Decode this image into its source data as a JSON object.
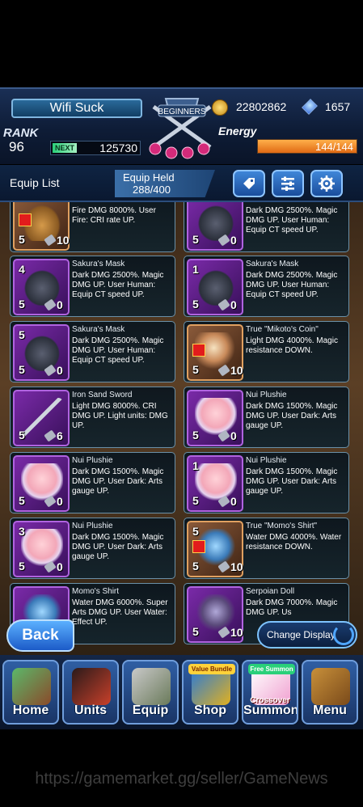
{
  "header": {
    "player_name": "Wifi Suck",
    "emblem_text": "BEGINNERS",
    "rank_label": "RANK",
    "rank": "96",
    "next_label": "NEXT",
    "next_xp": "125730",
    "coins": "22802862",
    "gems": "1657",
    "energy_label": "Energy",
    "energy": "144/144",
    "energy_fraction": 1.0
  },
  "subbar": {
    "title": "Equip List",
    "held_label": "Equip Held",
    "held_value": "288/400",
    "buttons": [
      "tag-icon",
      "filter-icon",
      "gear-icon"
    ]
  },
  "cards": [
    {
      "name": "",
      "level": "5",
      "count": "10",
      "desc": "Fire DMG 8000%. User Fire: CRI rate UP.",
      "art": "hat",
      "frame": "red"
    },
    {
      "name": "",
      "level": "5",
      "count": "0",
      "desc": "Dark DMG 2500%. Magic DMG UP. User Human: Equip CT speed UP.",
      "art": "mask",
      "frame": "purple"
    },
    {
      "name": "Sakura's Mask",
      "level": "5",
      "count": "0",
      "desc": "Dark DMG 2500%. Magic DMG UP. User Human: Equip CT speed UP.",
      "art": "mask",
      "frame": "purple",
      "top": "4"
    },
    {
      "name": "Sakura's Mask",
      "level": "5",
      "count": "0",
      "desc": "Dark DMG 2500%. Magic DMG UP. User Human: Equip CT speed UP.",
      "art": "mask",
      "frame": "purple",
      "top": "1"
    },
    {
      "name": "Sakura's Mask",
      "level": "5",
      "count": "0",
      "desc": "Dark DMG 2500%. Magic DMG UP. User Human: Equip CT speed UP.",
      "art": "mask",
      "frame": "purple",
      "top": "5"
    },
    {
      "name": "True \"Mikoto's Coin\"",
      "level": "5",
      "count": "10",
      "desc": "Light DMG 4000%. Magic resistance DOWN.",
      "art": "coin",
      "frame": "red"
    },
    {
      "name": "Iron Sand Sword",
      "level": "5",
      "count": "6",
      "desc": "Light DMG 8000%. CRI DMG UP. Light units: DMG UP.",
      "art": "sword",
      "frame": "purple"
    },
    {
      "name": "Nui Plushie",
      "level": "5",
      "count": "0",
      "desc": "Dark DMG 1500%. Magic DMG UP. User Dark: Arts gauge UP.",
      "art": "plush",
      "frame": "purple"
    },
    {
      "name": "Nui Plushie",
      "level": "5",
      "count": "0",
      "desc": "Dark DMG 1500%. Magic DMG UP. User Dark: Arts gauge UP.",
      "art": "plush",
      "frame": "purple"
    },
    {
      "name": "Nui Plushie",
      "level": "5",
      "count": "0",
      "desc": "Dark DMG 1500%. Magic DMG UP. User Dark: Arts gauge UP.",
      "art": "plush",
      "frame": "purple",
      "top": "1"
    },
    {
      "name": "Nui Plushie",
      "level": "5",
      "count": "0",
      "desc": "Dark DMG 1500%. Magic DMG UP. User Dark: Arts gauge UP.",
      "art": "plush",
      "frame": "purple",
      "top": "3"
    },
    {
      "name": "True \"Momo's Shirt\"",
      "level": "5",
      "count": "10",
      "desc": "Water DMG 4000%. Water resistance DOWN.",
      "art": "shirt",
      "frame": "red",
      "top": "5"
    },
    {
      "name": "Momo's Shirt",
      "level": "",
      "count": "",
      "desc": "Water DMG 6000%. Super Arts DMG UP. User Water: Effect UP.",
      "art": "shirt",
      "frame": "purple"
    },
    {
      "name": "Serpoian Doll",
      "level": "5",
      "count": "10",
      "desc": "Dark DMG 7000%. Magic DMG UP. Us",
      "art": "doll",
      "frame": "purple"
    }
  ],
  "actions": {
    "back": "Back",
    "change_display": "Change Display"
  },
  "nav": [
    {
      "label": "Home",
      "icon": "home-icon"
    },
    {
      "label": "Units",
      "icon": "units-icon"
    },
    {
      "label": "Equip",
      "icon": "equip-icon"
    },
    {
      "label": "Shop",
      "icon": "shop-icon",
      "tag": "Value Bundle"
    },
    {
      "label": "Summon",
      "icon": "summon-icon",
      "tag": "Free Summon",
      "sub": "Crossover"
    },
    {
      "label": "Menu",
      "icon": "menu-icon"
    }
  ],
  "watermark": "https://gamemarket.gg/seller/GameNews"
}
